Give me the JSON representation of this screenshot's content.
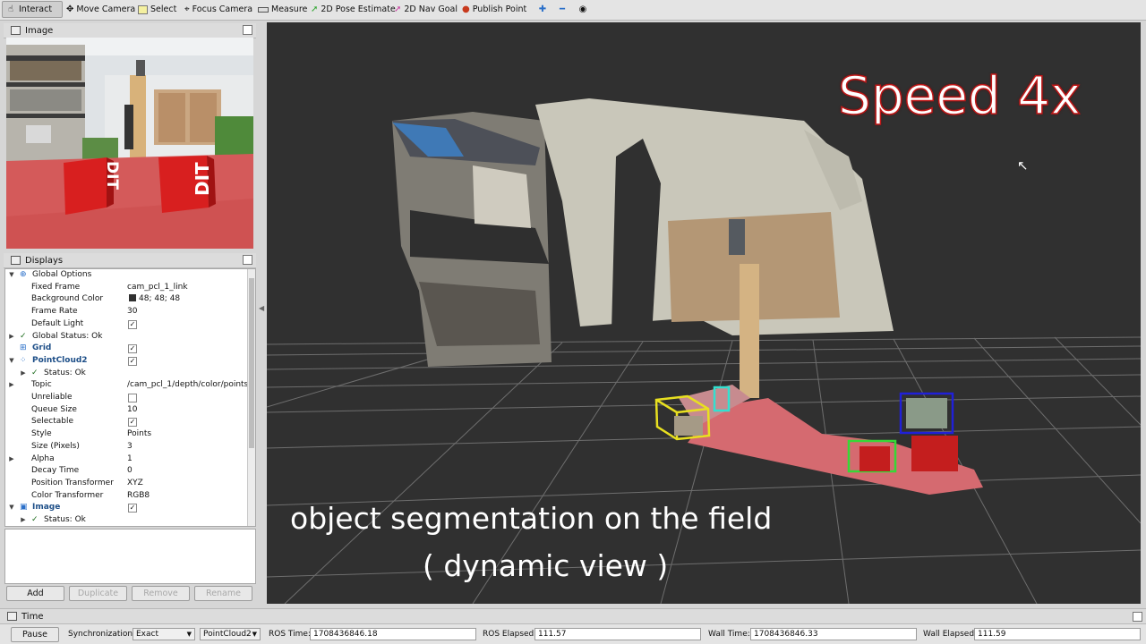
{
  "toolbar": {
    "items": [
      {
        "label": "Interact",
        "icon": "hand-cursor-icon"
      },
      {
        "label": "Move Camera",
        "icon": "move-arrows-icon"
      },
      {
        "label": "Select",
        "icon": "select-box-icon"
      },
      {
        "label": "Focus Camera",
        "icon": "focus-target-icon"
      },
      {
        "label": "Measure",
        "icon": "ruler-icon"
      },
      {
        "label": "2D Pose Estimate",
        "icon": "green-arrow-icon"
      },
      {
        "label": "2D Nav Goal",
        "icon": "pink-arrow-icon"
      },
      {
        "label": "Publish Point",
        "icon": "map-pin-icon"
      }
    ]
  },
  "image_panel": {
    "title": "Image",
    "cube_text": "DIT"
  },
  "displays": {
    "title": "Displays",
    "rows": [
      {
        "name": "Global Options",
        "value": ""
      },
      {
        "name": "Fixed Frame",
        "value": "cam_pcl_1_link"
      },
      {
        "name": "Background Color",
        "value": "48; 48; 48"
      },
      {
        "name": "Frame Rate",
        "value": "30"
      },
      {
        "name": "Default Light",
        "value": ""
      },
      {
        "name": "Global Status: Ok",
        "value": ""
      },
      {
        "name": "Grid",
        "value": ""
      },
      {
        "name": "PointCloud2",
        "value": ""
      },
      {
        "name": "Status: Ok",
        "value": ""
      },
      {
        "name": "Topic",
        "value": "/cam_pcl_1/depth/color/points"
      },
      {
        "name": "Unreliable",
        "value": ""
      },
      {
        "name": "Queue Size",
        "value": "10"
      },
      {
        "name": "Selectable",
        "value": ""
      },
      {
        "name": "Style",
        "value": "Points"
      },
      {
        "name": "Size (Pixels)",
        "value": "3"
      },
      {
        "name": "Alpha",
        "value": "1"
      },
      {
        "name": "Decay Time",
        "value": "0"
      },
      {
        "name": "Position Transformer",
        "value": "XYZ"
      },
      {
        "name": "Color Transformer",
        "value": "RGB8"
      },
      {
        "name": "Image",
        "value": ""
      },
      {
        "name": "Status: Ok",
        "value": ""
      }
    ]
  },
  "buttons": {
    "add": "Add",
    "duplicate": "Duplicate",
    "remove": "Remove",
    "rename": "Rename"
  },
  "view": {
    "speed_label": "Speed 4x",
    "caption_line1": "object segmentation on the field",
    "caption_line2": "( dynamic view )",
    "background_color": "#303030"
  },
  "time_panel": {
    "title": "Time"
  },
  "status": {
    "pause": "Pause",
    "sync_label": "Synchronization:",
    "sync_value": "Exact",
    "source_value": "PointCloud2",
    "ros_time_label": "ROS Time:",
    "ros_time": "1708436846.18",
    "ros_elapsed_label": "ROS Elapsed:",
    "ros_elapsed": "111.57",
    "wall_time_label": "Wall Time:",
    "wall_time": "1708436846.33",
    "wall_elapsed_label": "Wall Elapsed:",
    "wall_elapsed": "111.59"
  }
}
